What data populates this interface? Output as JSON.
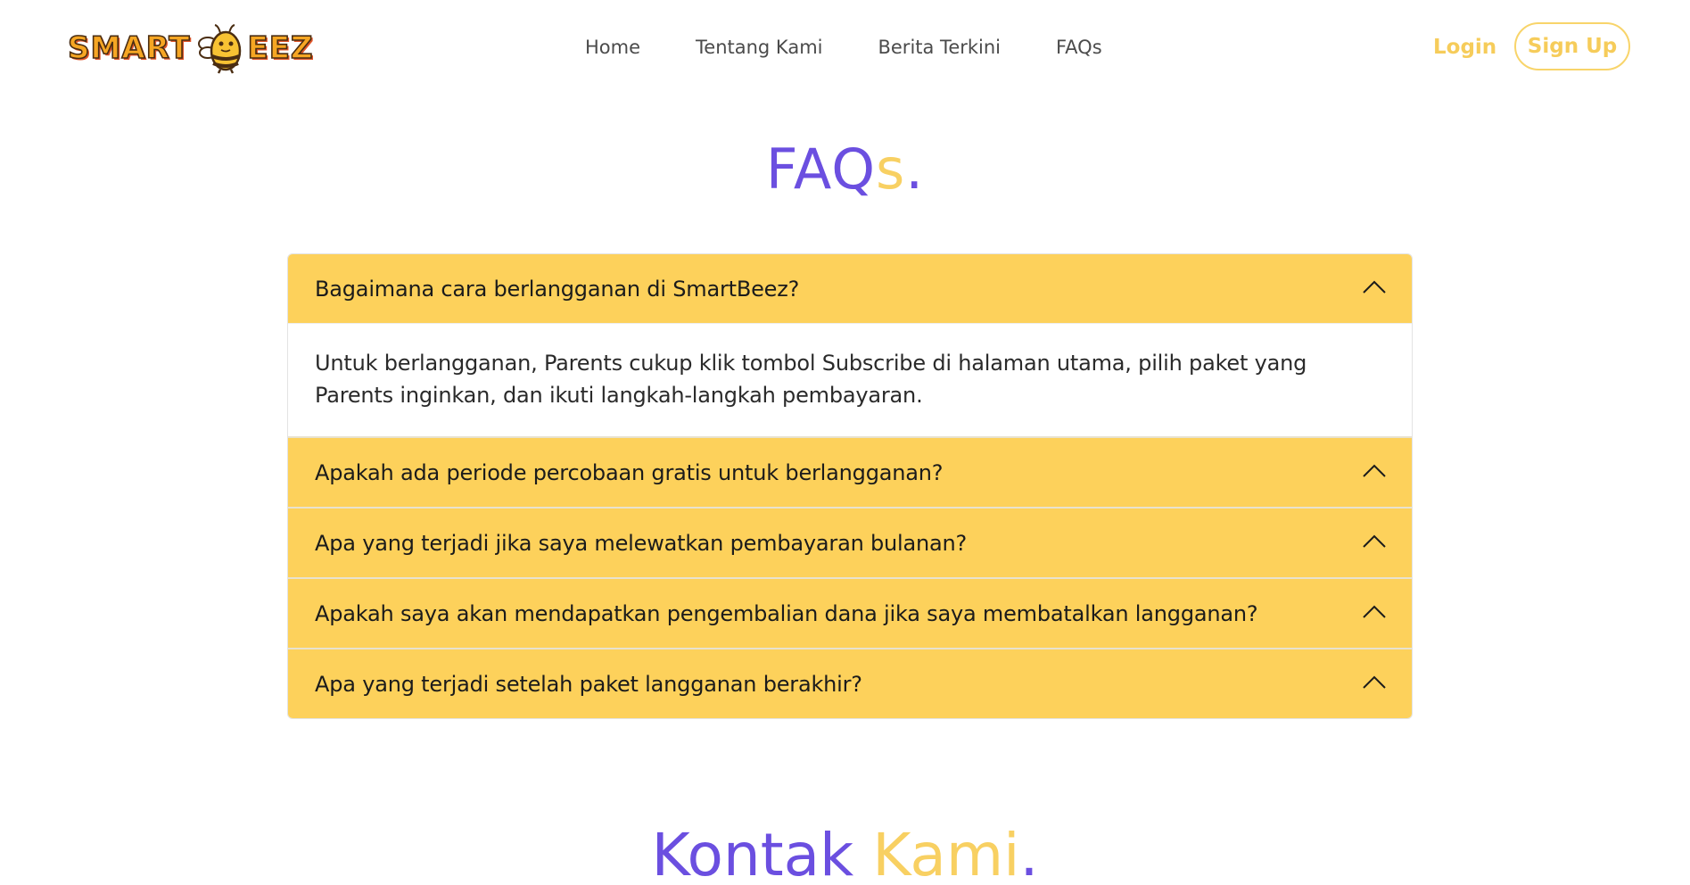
{
  "brand": {
    "logo_left": "SMART",
    "logo_right": "EEZ",
    "logo_alt": "SmartBeez"
  },
  "nav": {
    "items": [
      {
        "label": "Home"
      },
      {
        "label": "Tentang Kami"
      },
      {
        "label": "Berita Terkini"
      },
      {
        "label": "FAQs"
      }
    ],
    "login_label": "Login",
    "signup_label": "Sign Up"
  },
  "faq_section": {
    "title_main": "FAQ",
    "title_accent": "s",
    "title_dot": "."
  },
  "faqs": [
    {
      "question": "Bagaimana cara berlangganan di SmartBeez?",
      "answer": "Untuk berlangganan, Parents cukup klik tombol Subscribe di halaman utama, pilih paket yang Parents inginkan, dan ikuti langkah-langkah pembayaran.",
      "expanded": true
    },
    {
      "question": "Apakah ada periode percobaan gratis untuk berlangganan?",
      "expanded": false
    },
    {
      "question": "Apa yang terjadi jika saya melewatkan pembayaran bulanan?",
      "expanded": false
    },
    {
      "question": "Apakah saya akan mendapatkan pengembalian dana jika saya membatalkan langganan?",
      "expanded": false
    },
    {
      "question": "Apa yang terjadi setelah paket langganan berakhir?",
      "expanded": false
    }
  ],
  "contact_section": {
    "title_main": "Kontak",
    "title_accent": "Kami",
    "title_dot": "."
  },
  "colors": {
    "purple": "#6b4fe0",
    "yellow": "#f8d062",
    "accordion_header": "#fdd15b"
  },
  "icons": {
    "accordion_toggle": "chevron-up-icon",
    "logo_mascot": "bee-icon"
  }
}
